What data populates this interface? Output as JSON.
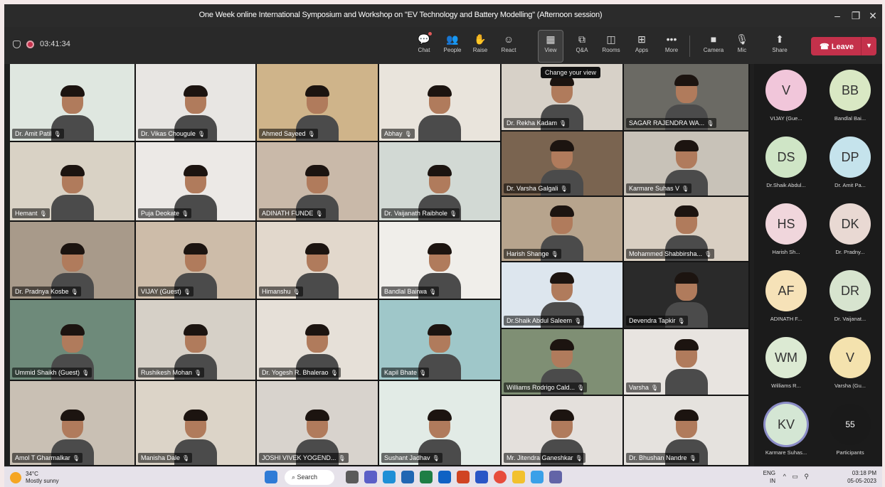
{
  "window": {
    "title": "One Week online International Symposium and Workshop on \"EV Technology and Battery Modelling\" (Afternoon session)"
  },
  "meeting": {
    "elapsed": "03:41:34"
  },
  "toolbar": {
    "chat": "Chat",
    "people": "People",
    "raise": "Raise",
    "react": "React",
    "view": "View",
    "qa": "Q&A",
    "rooms": "Rooms",
    "apps": "Apps",
    "more": "More",
    "camera": "Camera",
    "mic": "Mic",
    "share": "Share",
    "leave": "Leave"
  },
  "tooltip": "Change your view",
  "participants": [
    {
      "name": "Dr. Amit Patil",
      "bg": "#dfe7e0"
    },
    {
      "name": "Dr. Vikas Chougule",
      "bg": "#e8e6e3"
    },
    {
      "name": "Ahmed Sayeed",
      "bg": "#cfb48a"
    },
    {
      "name": "Abhay",
      "bg": "#e9e4dc"
    },
    {
      "name": "Dr. Rekha Kadam",
      "bg": "#d7d1c8"
    },
    {
      "name": "SAGAR RAJENDRA WA...",
      "bg": "#6b6a64"
    },
    {
      "name": "Hemant",
      "bg": "#d9d2c5"
    },
    {
      "name": "Puja Deokate",
      "bg": "#ece9e6"
    },
    {
      "name": "ADINATH FUNDE",
      "bg": "#c9b9a9"
    },
    {
      "name": "Dr. Vaijanath Raibhole",
      "bg": "#d2d9d4"
    },
    {
      "name": "Dr. Varsha Galgali",
      "bg": "#7a6450"
    },
    {
      "name": "Karmare Suhas V",
      "bg": "#c8c2b8"
    },
    {
      "name": "Dr. Pradnya Kosbe",
      "bg": "#a89a8a"
    },
    {
      "name": "VIJAY (Guest)",
      "bg": "#cdbca9"
    },
    {
      "name": "Himanshu",
      "bg": "#e2d8cc"
    },
    {
      "name": "Bandlal Bairwa",
      "bg": "#f0eeea"
    },
    {
      "name": "Harish Shange",
      "bg": "#b7a48d"
    },
    {
      "name": "Mohammed Shabbirsha...",
      "bg": "#d9cfc2"
    },
    {
      "name": "Ummid Shaikh (Guest)",
      "bg": "#6e8a7a"
    },
    {
      "name": "Rushikesh Mohan",
      "bg": "#d6d0c7"
    },
    {
      "name": "Dr. Yogesh R. Bhalerao",
      "bg": "#e6e0d8"
    },
    {
      "name": "Kapil Bhate",
      "bg": "#9fc7c9"
    },
    {
      "name": "Dr.Shaik Abdul Saleem",
      "bg": "#dde6ee"
    },
    {
      "name": "Devendra Tapkir",
      "bg": "#2a2a2a"
    },
    {
      "name": "Williams Rodrigo Cald...",
      "bg": "#7f8f74"
    },
    {
      "name": "Varsha",
      "bg": "#e8e4e0"
    },
    {
      "name": "Amol T Gharmalkar",
      "bg": "#c9c0b4"
    },
    {
      "name": "Manisha Dale",
      "bg": "#dcd4c8"
    },
    {
      "name": "JOSHI VIVEK YOGEND...",
      "bg": "#d8d3cd"
    },
    {
      "name": "Sushant Jadhav",
      "bg": "#e2ebe6"
    },
    {
      "name": "Mr. Jitendra Ganeshkar",
      "bg": "#e4e0dc"
    },
    {
      "name": "Dr. Bhushan Nandre",
      "bg": "#e5e2de"
    }
  ],
  "sidebar": [
    {
      "initials": "V",
      "label": "VIJAY (Gue...",
      "color": "#f1c6da"
    },
    {
      "initials": "BB",
      "label": "Bandlal Bai...",
      "color": "#d9e8c4"
    },
    {
      "initials": "DS",
      "label": "Dr.Shaik Abdul...",
      "color": "#cfe5c6"
    },
    {
      "initials": "DP",
      "label": "Dr. Amit Pa...",
      "color": "#c5e3ec"
    },
    {
      "initials": "HS",
      "label": "Harish Sh...",
      "color": "#f0d6dc"
    },
    {
      "initials": "DK",
      "label": "Dr. Pradny...",
      "color": "#e9d9d3"
    },
    {
      "initials": "AF",
      "label": "ADINATH F...",
      "color": "#f6e2b8"
    },
    {
      "initials": "DR",
      "label": "Dr. Vaijanat...",
      "color": "#d7e4cf"
    },
    {
      "initials": "WM",
      "label": "Williams R...",
      "color": "#dcead3"
    },
    {
      "initials": "V",
      "label": "Varsha (Gu...",
      "color": "#f4e2ae"
    },
    {
      "initials": "KV",
      "label": "Karmare Suhas...",
      "color": "#d4e6d4"
    },
    {
      "initials": "55",
      "label": "Participants",
      "color": "#1a1a1a"
    }
  ],
  "taskbar": {
    "temp": "34°C",
    "weather": "Mostly sunny",
    "search": "Search",
    "lang": "ENG",
    "region": "IN",
    "time": "03:18 PM",
    "date": "05-05-2023"
  }
}
